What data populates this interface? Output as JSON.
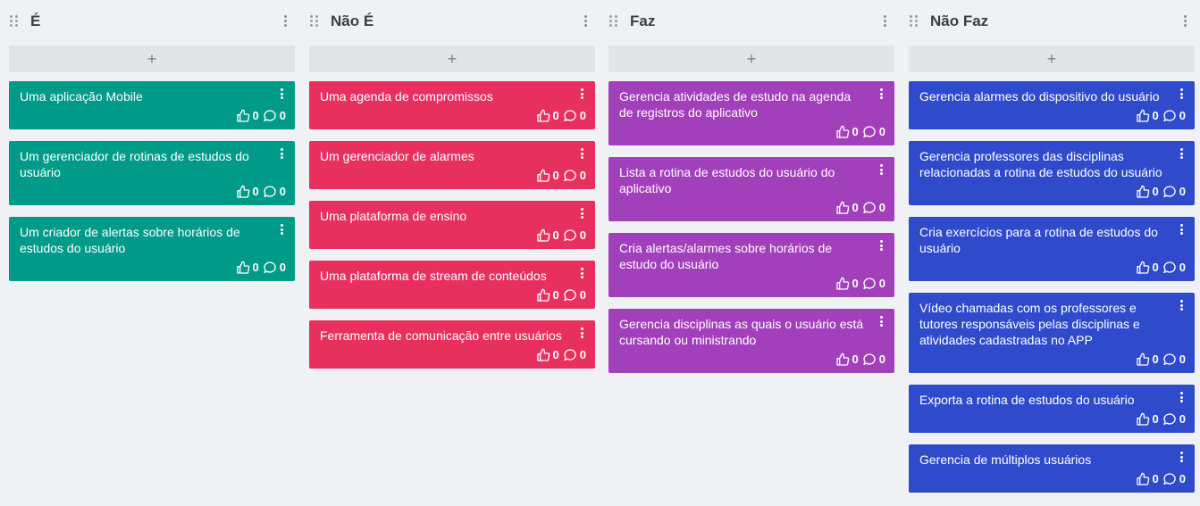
{
  "add_symbol": "+",
  "columns": [
    {
      "title": "É",
      "color": "#009b88",
      "cards": [
        {
          "text": "Uma aplicação Mobile",
          "likes": "0",
          "comments": "0"
        },
        {
          "text": "Um gerenciador de rotinas de estudos do usuário",
          "likes": "0",
          "comments": "0"
        },
        {
          "text": "Um criador de alertas sobre horários de estudos do usuário",
          "likes": "0",
          "comments": "0"
        }
      ]
    },
    {
      "title": "Não É",
      "color": "#e8305f",
      "cards": [
        {
          "text": "Uma agenda de compromissos",
          "likes": "0",
          "comments": "0"
        },
        {
          "text": "Um gerenciador de alarmes",
          "likes": "0",
          "comments": "0"
        },
        {
          "text": "Uma plataforma de ensino",
          "likes": "0",
          "comments": "0"
        },
        {
          "text": "Uma plataforma de stream de conteúdos",
          "likes": "0",
          "comments": "0"
        },
        {
          "text": "Ferramenta de comunicação entre usuários",
          "likes": "0",
          "comments": "0"
        }
      ]
    },
    {
      "title": "Faz",
      "color": "#a23fba",
      "cards": [
        {
          "text": "Gerencia atividades de estudo na agenda de registros do aplicativo",
          "likes": "0",
          "comments": "0"
        },
        {
          "text": "Lista a rotina de estudos do usuário do aplicativo",
          "likes": "0",
          "comments": "0"
        },
        {
          "text": "Cria alertas/alarmes sobre horários de estudo do usuário",
          "likes": "0",
          "comments": "0"
        },
        {
          "text": "Gerencia disciplinas as quais o usuário está cursando ou ministrando",
          "likes": "0",
          "comments": "0"
        }
      ]
    },
    {
      "title": "Não Faz",
      "color": "#2f4bcc",
      "cards": [
        {
          "text": "Gerencia alarmes do dispositivo do usuário",
          "likes": "0",
          "comments": "0"
        },
        {
          "text": "Gerencia professores das disciplinas relacionadas a rotina de estudos do usuário",
          "likes": "0",
          "comments": "0"
        },
        {
          "text": "Cria exercícios para a rotina de estudos do usuário",
          "likes": "0",
          "comments": "0"
        },
        {
          "text": "Vídeo chamadas com os professores e tutores responsáveis pelas disciplinas e atividades cadastradas no APP",
          "likes": "0",
          "comments": "0"
        },
        {
          "text": "Exporta a rotina de estudos do usuário",
          "likes": "0",
          "comments": "0"
        },
        {
          "text": "Gerencia de múltiplos usuários",
          "likes": "0",
          "comments": "0"
        }
      ]
    }
  ]
}
